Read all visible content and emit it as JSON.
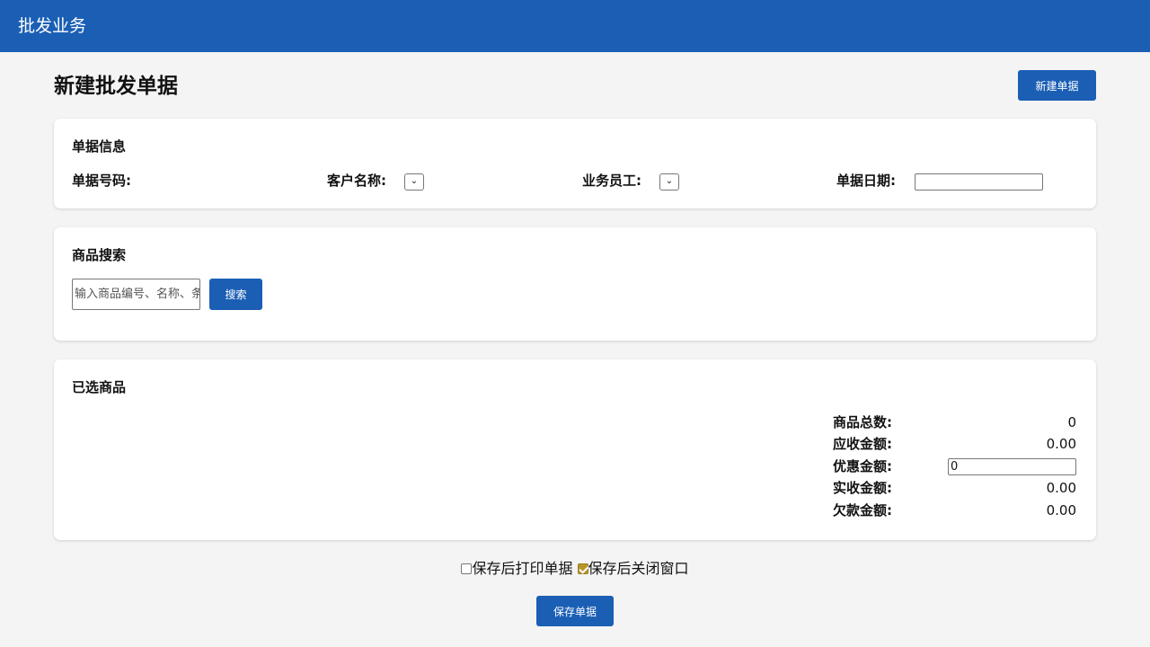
{
  "header": {
    "title": "批发业务"
  },
  "page": {
    "title": "新建批发单据",
    "new_button": "新建单据"
  },
  "doc_info": {
    "title": "单据信息",
    "fields": {
      "doc_number": "单据号码:",
      "customer": "客户名称:",
      "staff": "业务员工:",
      "date": "单据日期:"
    },
    "customer_value": "",
    "staff_value": "",
    "date_value": ""
  },
  "search": {
    "title": "商品搜索",
    "placeholder": "输入商品编号、名称、条码",
    "button": "搜索"
  },
  "selected": {
    "title": "已选商品",
    "summary": {
      "total_label": "商品总数:",
      "total_value": "0",
      "receivable_label": "应收金额:",
      "receivable_value": "0.00",
      "discount_label": "优惠金额:",
      "discount_value": "0",
      "actual_label": "实收金额:",
      "actual_value": "0.00",
      "debt_label": "欠款金额:",
      "debt_value": "0.00"
    }
  },
  "options": {
    "print_after_save": {
      "label": "保存后打印单据",
      "checked": false
    },
    "close_after_save": {
      "label": "保存后关闭窗口",
      "checked": true
    }
  },
  "save_button": "保存单据",
  "colors": {
    "primary": "#1b5fb5",
    "background": "#f4f4f4",
    "checkbox_checked": "#b8952b"
  }
}
